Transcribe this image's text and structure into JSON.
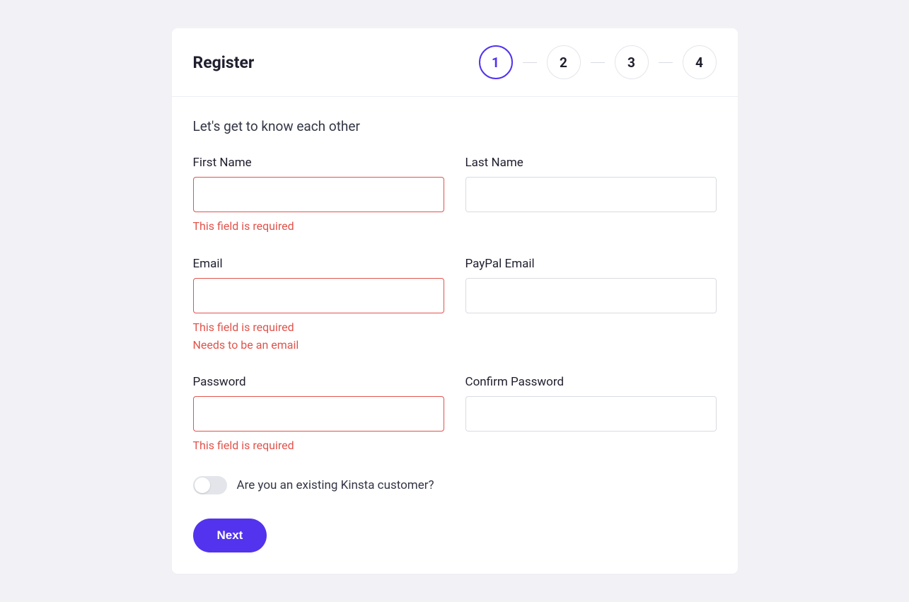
{
  "header": {
    "title": "Register",
    "steps": [
      "1",
      "2",
      "3",
      "4"
    ],
    "active_index": 0
  },
  "body": {
    "subtitle": "Let's get to know each other",
    "fields": {
      "first_name": {
        "label": "First Name",
        "value": "",
        "errors": [
          "This field is required"
        ]
      },
      "last_name": {
        "label": "Last Name",
        "value": "",
        "errors": []
      },
      "email": {
        "label": "Email",
        "value": "",
        "errors": [
          "This field is required",
          "Needs to be an email"
        ]
      },
      "paypal_email": {
        "label": "PayPal Email",
        "value": "",
        "errors": []
      },
      "password": {
        "label": "Password",
        "value": "",
        "errors": [
          "This field is required"
        ]
      },
      "confirm_password": {
        "label": "Confirm Password",
        "value": "",
        "errors": []
      }
    },
    "toggle": {
      "label": "Are you an existing Kinsta customer?",
      "value": false
    },
    "next_button": "Next"
  },
  "colors": {
    "accent": "#5333ed",
    "error": "#e2534b",
    "border": "#d8dbe2",
    "bg": "#f2f2f6"
  }
}
